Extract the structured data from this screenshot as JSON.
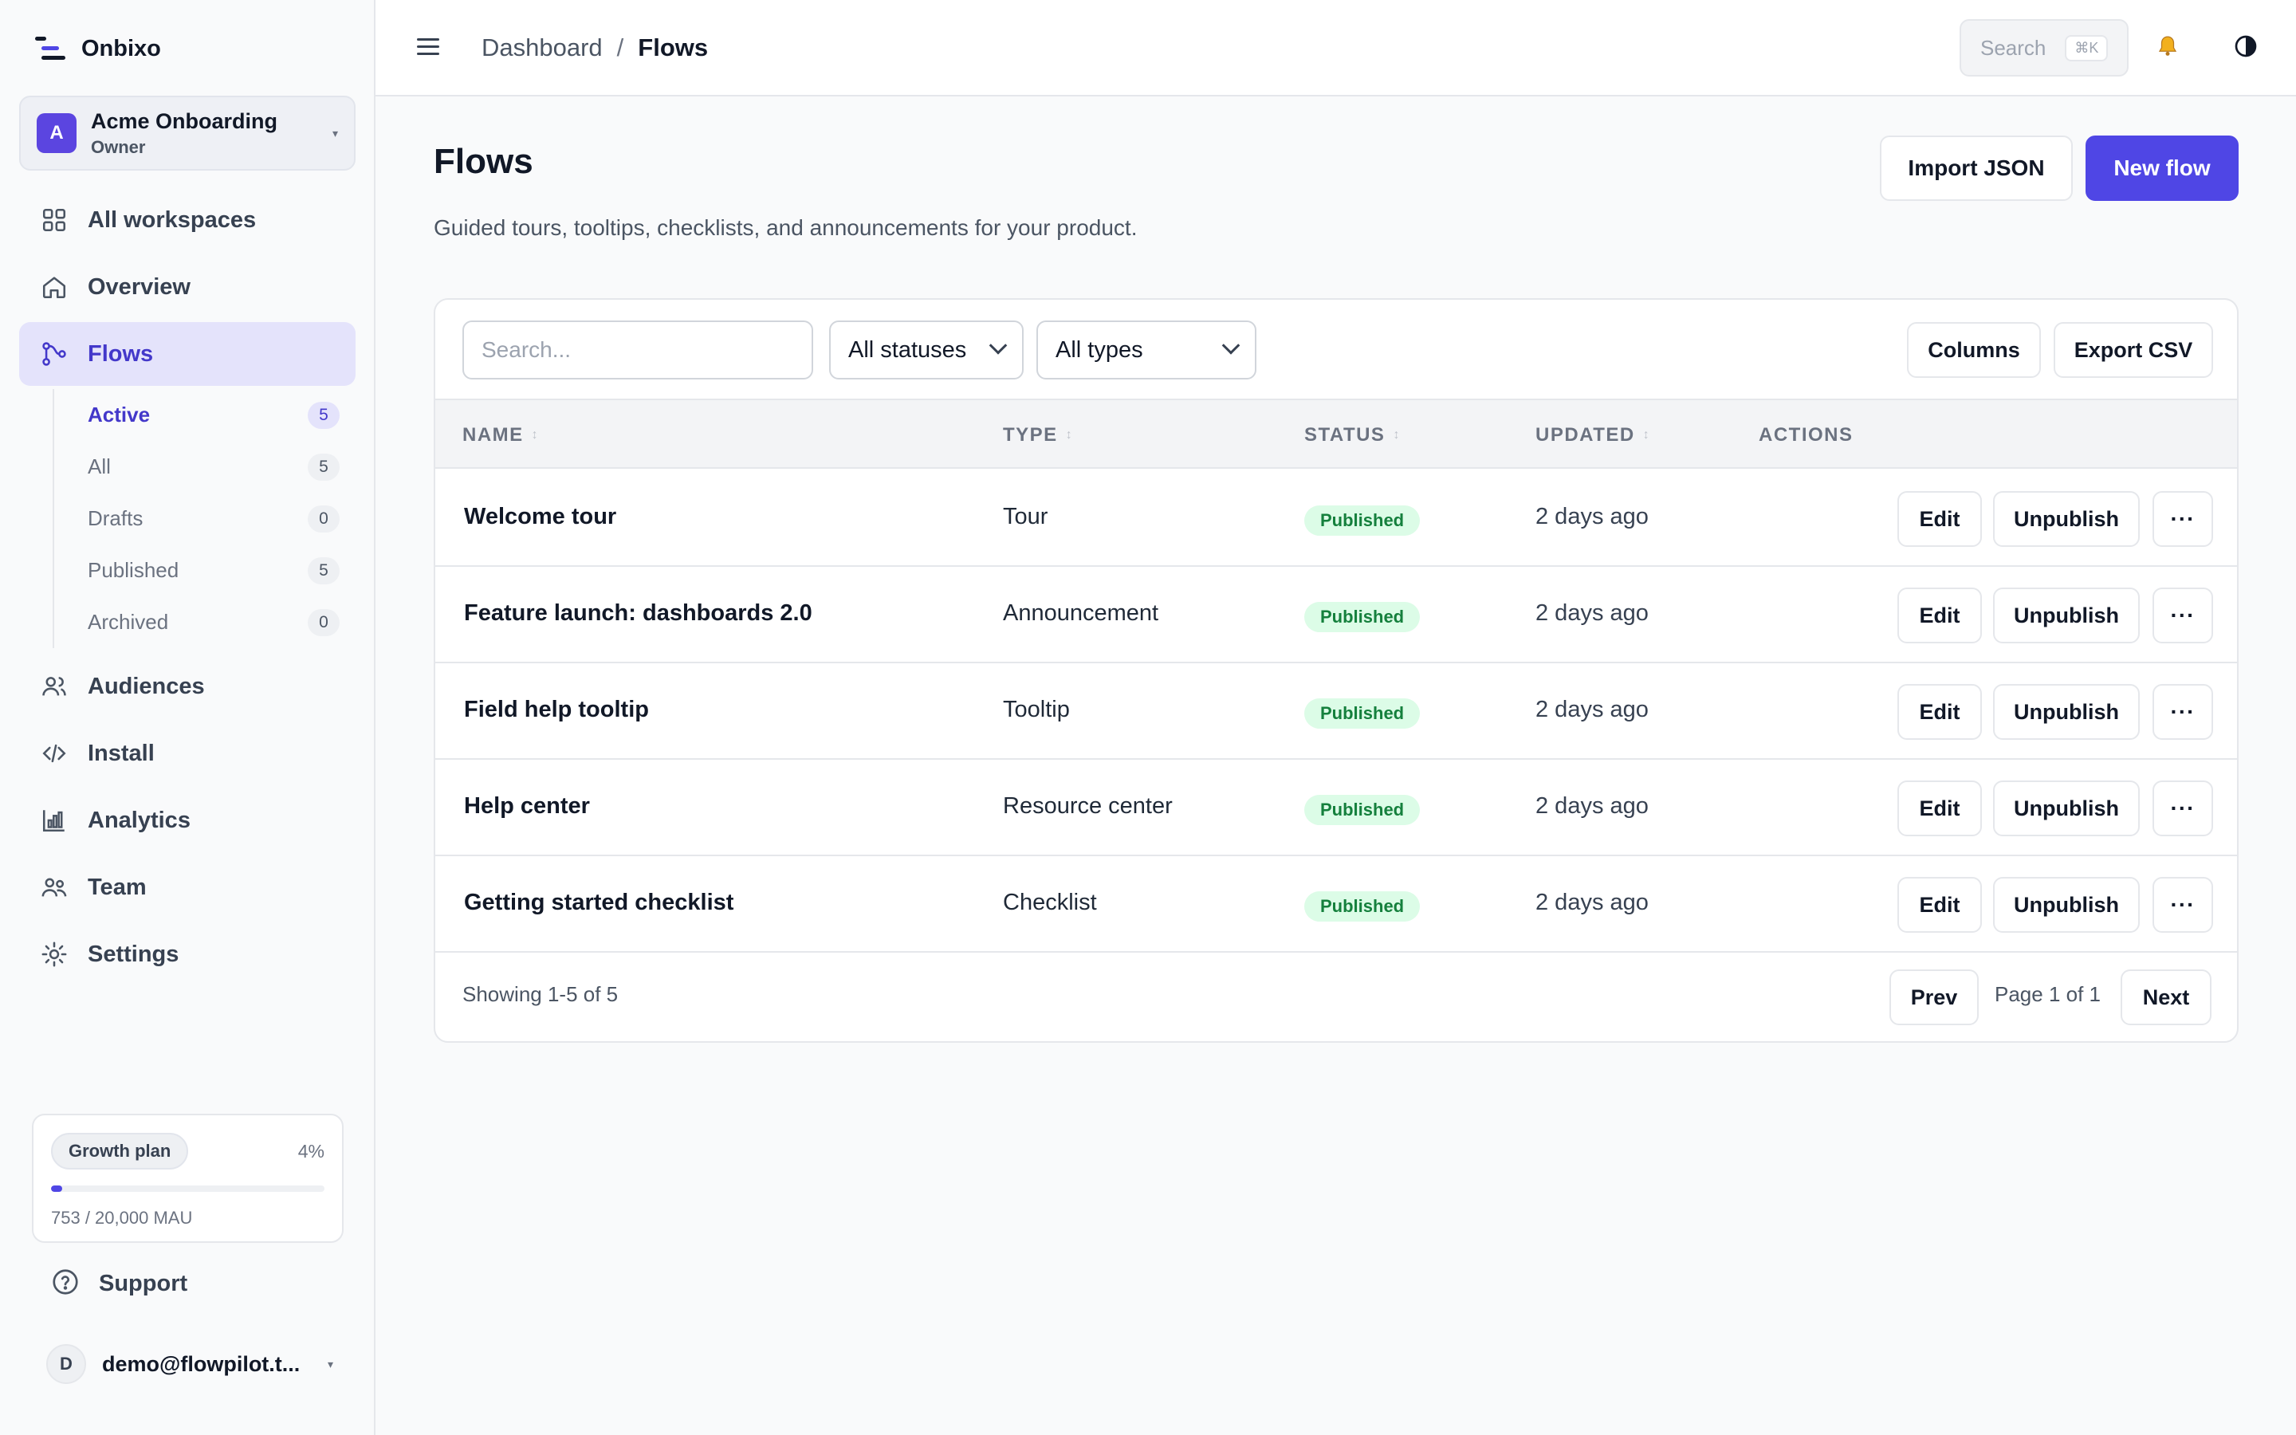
{
  "brand": {
    "name": "Onbixo"
  },
  "workspace": {
    "initial": "A",
    "name": "Acme Onboarding",
    "role": "Owner"
  },
  "nav": {
    "all_workspaces": "All workspaces",
    "overview": "Overview",
    "flows": "Flows",
    "audiences": "Audiences",
    "install": "Install",
    "analytics": "Analytics",
    "team": "Team",
    "settings": "Settings"
  },
  "flows_sub": [
    {
      "label": "Active",
      "count": "5"
    },
    {
      "label": "All",
      "count": "5"
    },
    {
      "label": "Drafts",
      "count": "0"
    },
    {
      "label": "Published",
      "count": "5"
    },
    {
      "label": "Archived",
      "count": "0"
    }
  ],
  "plan": {
    "name": "Growth plan",
    "percent_label": "4%",
    "percent": 0.04,
    "usage": "753 / 20,000 MAU"
  },
  "support": {
    "label": "Support"
  },
  "user": {
    "initial": "D",
    "email": "demo@flowpilot.t..."
  },
  "topbar": {
    "breadcrumb": [
      "Dashboard",
      "/",
      "Flows"
    ],
    "search_label": "Search",
    "search_shortcut": "⌘K"
  },
  "page": {
    "title": "Flows",
    "subtitle": "Guided tours, tooltips, checklists, and announcements for your product.",
    "import_label": "Import JSON",
    "new_label": "New flow"
  },
  "filters": {
    "search_placeholder": "Search...",
    "status": "All statuses",
    "type": "All types",
    "columns_label": "Columns",
    "export_label": "Export CSV"
  },
  "table": {
    "headers": {
      "name": "NAME",
      "type": "TYPE",
      "status": "STATUS",
      "updated": "UPDATED",
      "actions": "ACTIONS"
    },
    "edit_label": "Edit",
    "unpublish_label": "Unpublish",
    "more_label": "···",
    "rows": [
      {
        "name": "Welcome tour",
        "type": "Tour",
        "status": "Published",
        "updated": "2 days ago"
      },
      {
        "name": "Feature launch: dashboards 2.0",
        "type": "Announcement",
        "status": "Published",
        "updated": "2 days ago"
      },
      {
        "name": "Field help tooltip",
        "type": "Tooltip",
        "status": "Published",
        "updated": "2 days ago"
      },
      {
        "name": "Help center",
        "type": "Resource center",
        "status": "Published",
        "updated": "2 days ago"
      },
      {
        "name": "Getting started checklist",
        "type": "Checklist",
        "status": "Published",
        "updated": "2 days ago"
      }
    ]
  },
  "pagination": {
    "showing": "Showing 1-5 of 5",
    "prev": "Prev",
    "page": "Page 1 of 1",
    "next": "Next"
  },
  "colors": {
    "accent": "#4f46e5",
    "published_bg": "#dcfce7",
    "published_fg": "#15803d"
  }
}
